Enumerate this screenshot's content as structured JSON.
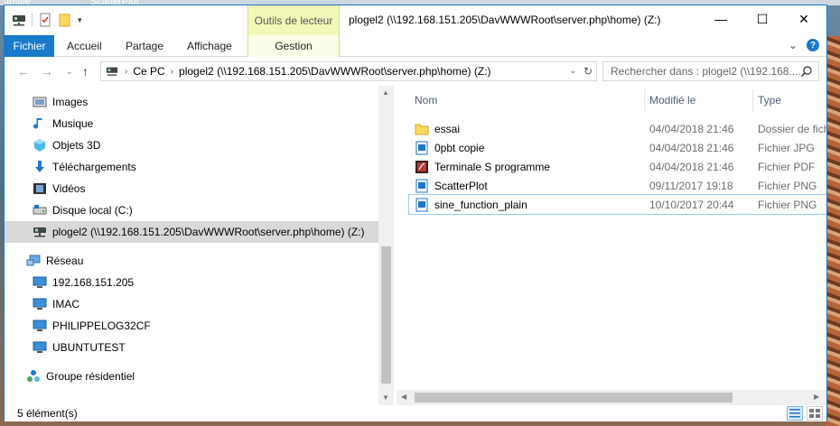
{
  "desktop": {
    "labels": [
      "amale",
      "ScatterPlot"
    ]
  },
  "window": {
    "title": "plogel2 (\\\\192.168.151.205\\DavWWWRoot\\server.php\\home) (Z:)",
    "context_tab": "Outils de lecteur",
    "controls": {
      "minimize": "—",
      "maximize": "☐",
      "close": "✕"
    }
  },
  "ribbon": {
    "tabs": [
      "Fichier",
      "Accueil",
      "Partage",
      "Affichage",
      "Gestion"
    ],
    "expand": "⌄",
    "help": "?"
  },
  "address": {
    "segments": [
      "Ce PC",
      "plogel2 (\\\\192.168.151.205\\DavWWWRoot\\server.php\\home) (Z:)"
    ],
    "search_placeholder": "Rechercher dans : plogel2 (\\\\192.168...."
  },
  "nav": {
    "items": [
      {
        "label": "Images",
        "icon": "pictures-icon"
      },
      {
        "label": "Musique",
        "icon": "music-icon"
      },
      {
        "label": "Objets 3D",
        "icon": "3d-objects-icon"
      },
      {
        "label": "Téléchargements",
        "icon": "downloads-icon"
      },
      {
        "label": "Vidéos",
        "icon": "videos-icon"
      },
      {
        "label": "Disque local (C:)",
        "icon": "local-disk-icon"
      },
      {
        "label": "plogel2 (\\\\192.168.151.205\\DavWWWRoot\\server.php\\home) (Z:)",
        "icon": "network-drive-icon"
      },
      {
        "label": "Réseau",
        "icon": "network-icon"
      },
      {
        "label": "192.168.151.205",
        "icon": "computer-icon"
      },
      {
        "label": "IMAC",
        "icon": "computer-icon"
      },
      {
        "label": "PHILIPPELOG32CF",
        "icon": "computer-icon"
      },
      {
        "label": "UBUNTUTEST",
        "icon": "computer-icon"
      },
      {
        "label": "Groupe résidentiel",
        "icon": "homegroup-icon"
      }
    ]
  },
  "files": {
    "columns": [
      "Nom",
      "Modifié le",
      "Type"
    ],
    "rows": [
      {
        "name": "essai",
        "date": "04/04/2018 21:46",
        "type": "Dossier de fichi",
        "icon": "folder-icon"
      },
      {
        "name": "0pbt copie",
        "date": "04/04/2018 21:46",
        "type": "Fichier JPG",
        "icon": "image-file-icon"
      },
      {
        "name": "Terminale S programme",
        "date": "04/04/2018 21:46",
        "type": "Fichier PDF",
        "icon": "pdf-file-icon"
      },
      {
        "name": "ScatterPlot",
        "date": "09/11/2017 19:18",
        "type": "Fichier PNG",
        "icon": "image-file-icon"
      },
      {
        "name": "sine_function_plain",
        "date": "10/10/2017 20:44",
        "type": "Fichier PNG",
        "icon": "image-file-icon"
      }
    ]
  },
  "status": {
    "count": "5 élément(s)"
  }
}
